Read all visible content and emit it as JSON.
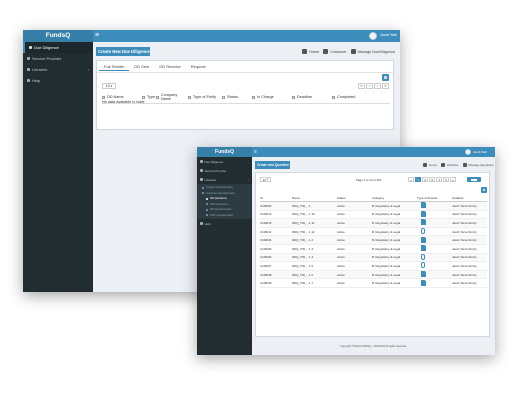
{
  "common": {
    "brand": "FundsQ",
    "user_name": "Jacob Wall",
    "hamburger_glyph": "≡",
    "accent": "#3c8dbc",
    "sidebar_bg": "#222d32"
  },
  "back_window": {
    "sidebar": {
      "items": [
        {
          "label": "Due Diligence",
          "icon": "checkbox-icon",
          "active": true
        },
        {
          "label": "Service Provider",
          "icon": "link-icon",
          "active": false
        },
        {
          "label": "Libraries",
          "icon": "book-icon",
          "active": false,
          "chevron": "‹"
        },
        {
          "label": "Help",
          "icon": "help-icon",
          "active": false
        }
      ]
    },
    "title_button": "Create New Due Diligence",
    "breadcrumbs": [
      "Home",
      "Customer",
      "Manage DueDiligence"
    ],
    "tabs": [
      "Full Shelter",
      "DD Sent",
      "DD Receive",
      "Request"
    ],
    "page_size": "10",
    "pager": [
      "«",
      "‹",
      "›",
      "»"
    ],
    "columns": [
      "DD Name",
      "Type",
      "Company Name",
      "Type of Entity",
      "Status",
      "In Charge",
      "Deadline",
      "Completed"
    ],
    "empty_text": "No data available in table"
  },
  "front_window": {
    "sidebar": {
      "items": [
        {
          "label": "Due Diligence",
          "icon": "checkbox-icon"
        },
        {
          "label": "Service Provider",
          "icon": "link-icon"
        },
        {
          "label": "Libraries",
          "icon": "book-icon",
          "chevron": "‹"
        }
      ],
      "sub_items": [
        {
          "label": "Content Questionnaire",
          "active": false
        },
        {
          "label": "Customer Questionnaire",
          "active": false
        },
        {
          "label": "DD Questions",
          "active": true
        },
        {
          "label": "DDF Questions",
          "active": false
        },
        {
          "label": "DD Questionnaire",
          "active": false
        },
        {
          "label": "DDF Questionnaire",
          "active": false
        }
      ],
      "help": "Help"
    },
    "title_button": "Create new Question",
    "breadcrumbs": [
      "Home",
      "Libraries",
      "Manage Questions"
    ],
    "page_size": "10",
    "page_info": "Page 1 to 10 of 151",
    "pager": [
      "«",
      "1",
      "2",
      "3",
      "4",
      "5",
      "»"
    ],
    "columns": [
      "Id",
      "Name",
      "Status",
      "Category",
      "Type of Answer",
      "Updated"
    ],
    "rows": [
      {
        "id": "C10ID03",
        "name": "DDQ_T06_...1",
        "status": "Active",
        "category": "B. Regulatory & Legal",
        "answer_icon": "document-icon",
        "updated": "Jacob Tersé Rontry"
      },
      {
        "id": "C10ID12",
        "name": "DDQ_T06_...1.10",
        "status": "Active",
        "category": "B. Regulatory & Legal",
        "answer_icon": "document-icon",
        "updated": "Jacob Tersé Rontry"
      },
      {
        "id": "C10ID13",
        "name": "DDQ_T06_...1.11",
        "status": "Active",
        "category": "B. Regulatory & Legal",
        "answer_icon": "document-icon",
        "updated": "Jacob Tersé Rontry"
      },
      {
        "id": "C10ID14",
        "name": "DDQ_T06_...1.12",
        "status": "Active",
        "category": "B. Regulatory & Legal",
        "answer_icon": "attachment-icon",
        "updated": "Jacob Tersé Rontry"
      },
      {
        "id": "C10ID04",
        "name": "DDQ_T06_...1.2",
        "status": "Active",
        "category": "B. Regulatory & Legal",
        "answer_icon": "document-icon",
        "updated": "Jacob Tersé Rontry"
      },
      {
        "id": "C10ID05",
        "name": "DDQ_T06_...1.3",
        "status": "Active",
        "category": "B. Regulatory & Legal",
        "answer_icon": "document-icon",
        "updated": "Jacob Tersé Rontry"
      },
      {
        "id": "C10ID06",
        "name": "DDQ_T06_...1.4",
        "status": "Active",
        "category": "B. Regulatory & Legal",
        "answer_icon": "attachment-icon",
        "updated": "Jacob Tersé Rontry"
      },
      {
        "id": "C10ID07",
        "name": "DDQ_T06_...1.5",
        "status": "Active",
        "category": "B. Regulatory & Legal",
        "answer_icon": "attachment-icon",
        "updated": "Jacob Tersé Rontry"
      },
      {
        "id": "C10ID08",
        "name": "DDQ_T06_...1.6",
        "status": "Active",
        "category": "B. Regulatory & Legal",
        "answer_icon": "document-icon",
        "updated": "Jacob Tersé Rontry"
      },
      {
        "id": "C10ID09",
        "name": "DDQ_T06_...1.7",
        "status": "Active",
        "category": "B. Regulatory & Legal",
        "answer_icon": "document-icon",
        "updated": "Jacob Tersé Rontry"
      }
    ],
    "footer": "Copyright ©2019 FUNDSQ - FDS/PLM All rights reserved."
  }
}
